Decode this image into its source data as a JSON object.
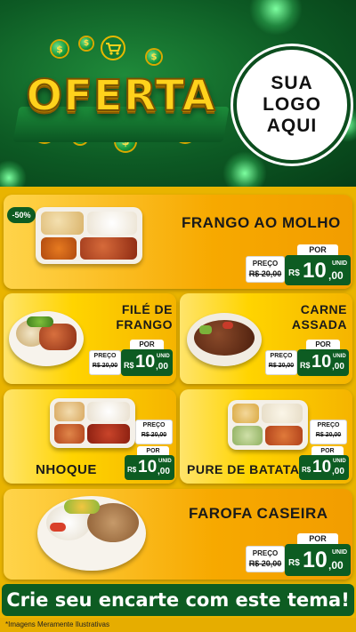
{
  "header": {
    "brand_banner": "OFERTA",
    "logo_lines": [
      "SUA",
      "LOGO",
      "AQUI"
    ],
    "coin_symbol": "$"
  },
  "colors": {
    "dark_green": "#0d5c22",
    "yellow": "#ffd400",
    "orange": "#f29d00"
  },
  "products": {
    "frango": {
      "badge": "-50%",
      "name": "FRANGO AO MOLHO",
      "old_label": "PREÇO",
      "old_price": "R$ 20,00",
      "por": "POR",
      "currency": "R$",
      "price_int": "10",
      "price_cents": ",00",
      "unit": "UNID"
    },
    "file": {
      "name_line1": "FILÉ DE",
      "name_line2": "FRANGO",
      "old_label": "PREÇO",
      "old_price": "R$ 20,00",
      "por": "POR",
      "currency": "R$",
      "price_int": "10",
      "price_cents": ",00",
      "unit": "UNID"
    },
    "carne": {
      "name_line1": "CARNE",
      "name_line2": "ASSADA",
      "old_label": "PREÇO",
      "old_price": "R$ 20,00",
      "por": "POR",
      "currency": "R$",
      "price_int": "10",
      "price_cents": ",00",
      "unit": "UNID"
    },
    "nhoque": {
      "name": "NHOQUE",
      "old_label": "PREÇO",
      "old_price": "R$ 20,00",
      "por": "POR",
      "currency": "R$",
      "price_int": "10",
      "price_cents": ",00",
      "unit": "UNID"
    },
    "pure": {
      "name": "PURE DE BATATA",
      "old_label": "PREÇO",
      "old_price": "R$ 20,00",
      "por": "POR",
      "currency": "R$",
      "price_int": "10",
      "price_cents": ",00",
      "unit": "UNID"
    },
    "farofa": {
      "name": "FAROFA CASEIRA",
      "old_label": "PREÇO",
      "old_price": "R$ 20,00",
      "por": "POR",
      "currency": "R$",
      "price_int": "10",
      "price_cents": ",00",
      "unit": "UNID"
    }
  },
  "cta": "Crie seu encarte com este tema!",
  "footer_note": "*Imagens Meramente Ilustrativas"
}
